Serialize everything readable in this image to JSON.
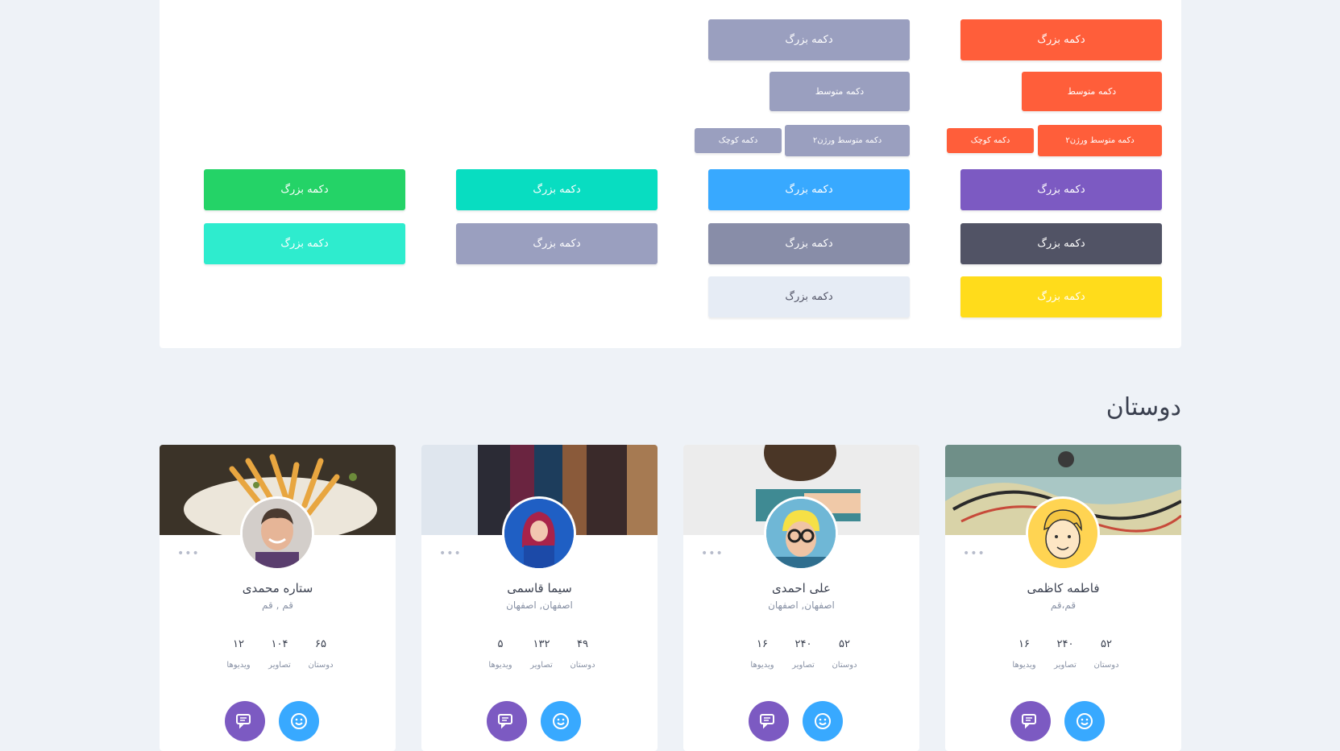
{
  "buttons": {
    "large": "دکمه بزرگ",
    "medium": "دکمه متوسط",
    "medium_v2": "دکمه متوسط ورژن۲",
    "small": "دکمه کوچک"
  },
  "colors": {
    "orange": "#ff5e3a",
    "grey_blue": "#9a9fbf",
    "purple": "#7c5ac2",
    "blue": "#38a9ff",
    "teal": "#08ddc1",
    "green": "#24d367",
    "dark": "#515365",
    "slate": "#888da8",
    "mint": "#2eecce",
    "light": "#e6ecf5",
    "yellow": "#ffdc1b"
  },
  "friends": {
    "title": "دوستان",
    "stat_labels": {
      "friends": "دوستان",
      "photos": "تصاویر",
      "videos": "ویدیوها"
    },
    "cards": [
      {
        "name": "فاطمه کاظمی",
        "location": "قم،قم",
        "friends": "۵۲",
        "photos": "۲۴۰",
        "videos": "۱۶",
        "more": "•••"
      },
      {
        "name": "علی احمدی",
        "location": "اصفهان, اصفهان",
        "friends": "۵۲",
        "photos": "۲۴۰",
        "videos": "۱۶",
        "more": "•••"
      },
      {
        "name": "سیما قاسمی",
        "location": "اصفهان, اصفهان",
        "friends": "۴۹",
        "photos": "۱۳۲",
        "videos": "۵",
        "more": "•••"
      },
      {
        "name": "ستاره محمدی",
        "location": "قم , قم",
        "friends": "۶۵",
        "photos": "۱۰۴",
        "videos": "۱۲",
        "more": "•••"
      }
    ]
  }
}
